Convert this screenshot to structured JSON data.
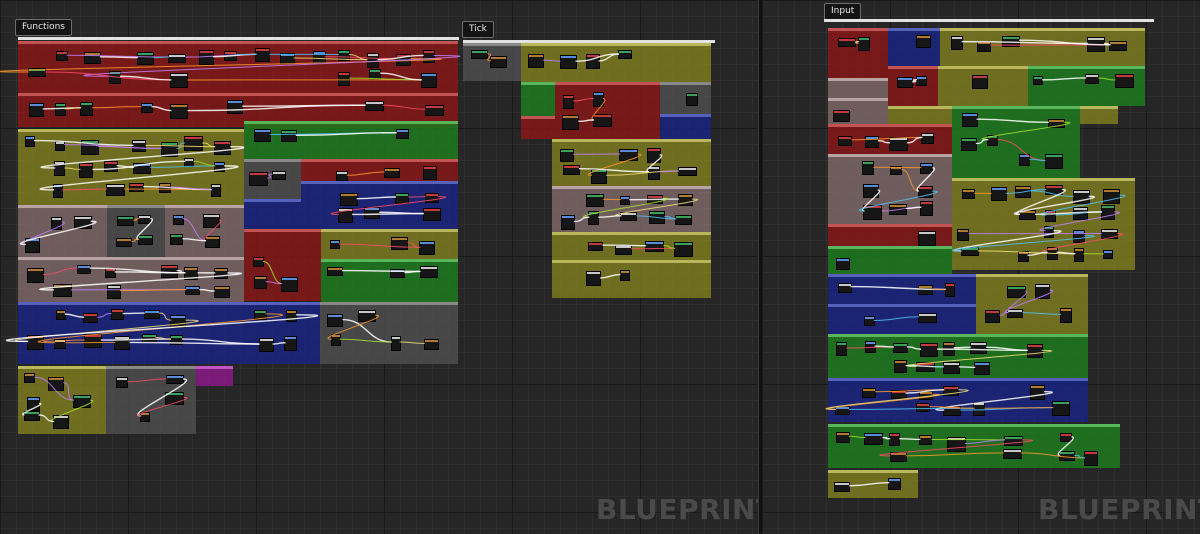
{
  "graphs": [
    {
      "id": "left",
      "tabs": [
        {
          "label": "Functions"
        },
        {
          "label": "Tick"
        }
      ],
      "watermark": "BLUEPRINT"
    },
    {
      "id": "right",
      "tabs": [
        {
          "label": "Input"
        }
      ],
      "watermark": "BLUEPRINT"
    }
  ],
  "colors": {
    "background": "#262626",
    "comment_red": "#861818",
    "comment_olive": "#7d7a1f",
    "comment_green": "#1e7a1e",
    "comment_blue": "#1a2580",
    "comment_pink": "#7d6666",
    "comment_grey": "#4d4d4d",
    "comment_magenta": "#8a1a8a",
    "exec_wire": "#ffffff",
    "data_wires": [
      "#4fc3f7",
      "#a6e22e",
      "#ff4a6a",
      "#ff9a2e",
      "#c47cff",
      "#f6e27a"
    ]
  }
}
